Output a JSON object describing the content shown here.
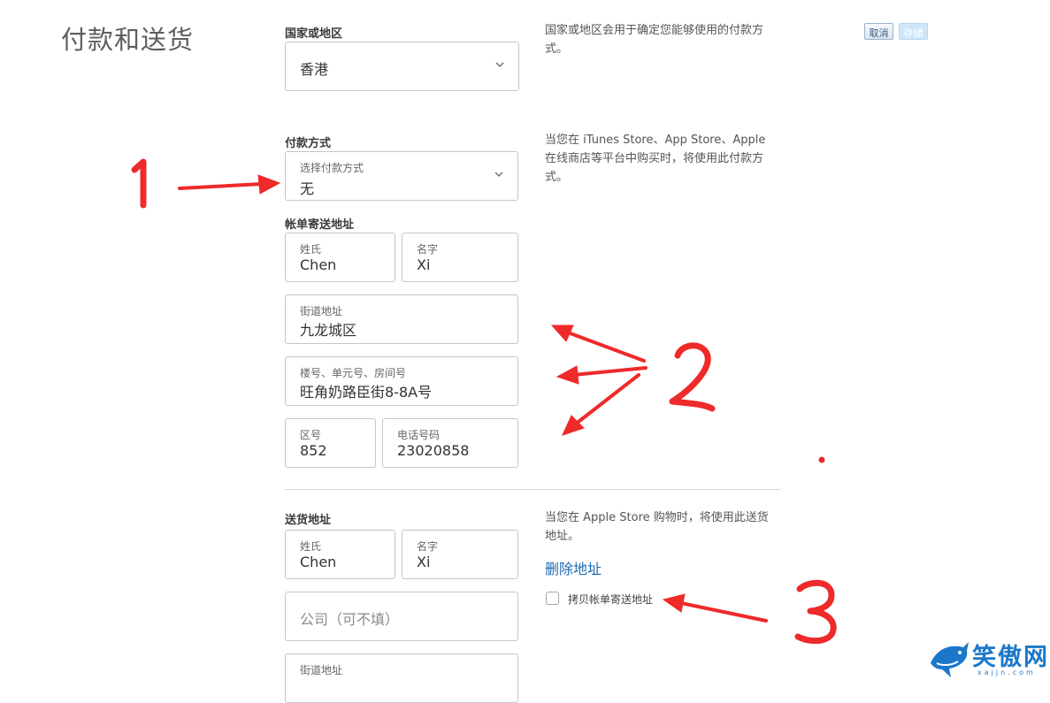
{
  "page": {
    "title": "付款和送货"
  },
  "toolbar": {
    "cancel_label": "取消",
    "save_label": "存储"
  },
  "country": {
    "label": "国家或地区",
    "value": "香港",
    "help": "国家或地区会用于确定您能够使用的付款方式。",
    "icon": "chevron-down-icon"
  },
  "payment": {
    "label": "付款方式",
    "select_label": "选择付款方式",
    "value": "无",
    "help": "当您在 iTunes Store、App Store、Apple 在线商店等平台中购买时，将使用此付款方式。"
  },
  "billing": {
    "label": "帐单寄送地址",
    "last_name_label": "姓氏",
    "last_name": "Chen",
    "first_name_label": "名字",
    "first_name": "Xi",
    "street_label": "街道地址",
    "street": "九龙城区",
    "building_label": "楼号、单元号、房间号",
    "building": "旺角奶路臣街8-8A号",
    "area_code_label": "区号",
    "area_code": "852",
    "phone_label": "电话号码",
    "phone": "23020858"
  },
  "shipping": {
    "label": "送货地址",
    "help": "当您在 Apple Store 购物时，将使用此送货地址。",
    "delete_link": "删除地址",
    "copy_billing_label": "拷贝帐单寄送地址",
    "copy_billing_checked": false,
    "last_name_label": "姓氏",
    "last_name": "Chen",
    "first_name_label": "名字",
    "first_name": "Xi",
    "company_placeholder": "公司（可不填）",
    "street_label": "街道地址"
  },
  "watermark": {
    "logo_text": "笑傲网",
    "domain": "xajjn.com"
  },
  "colors": {
    "link": "#1d6ab0",
    "annotation": "#ee2a2a",
    "border": "#c6c6c6"
  }
}
